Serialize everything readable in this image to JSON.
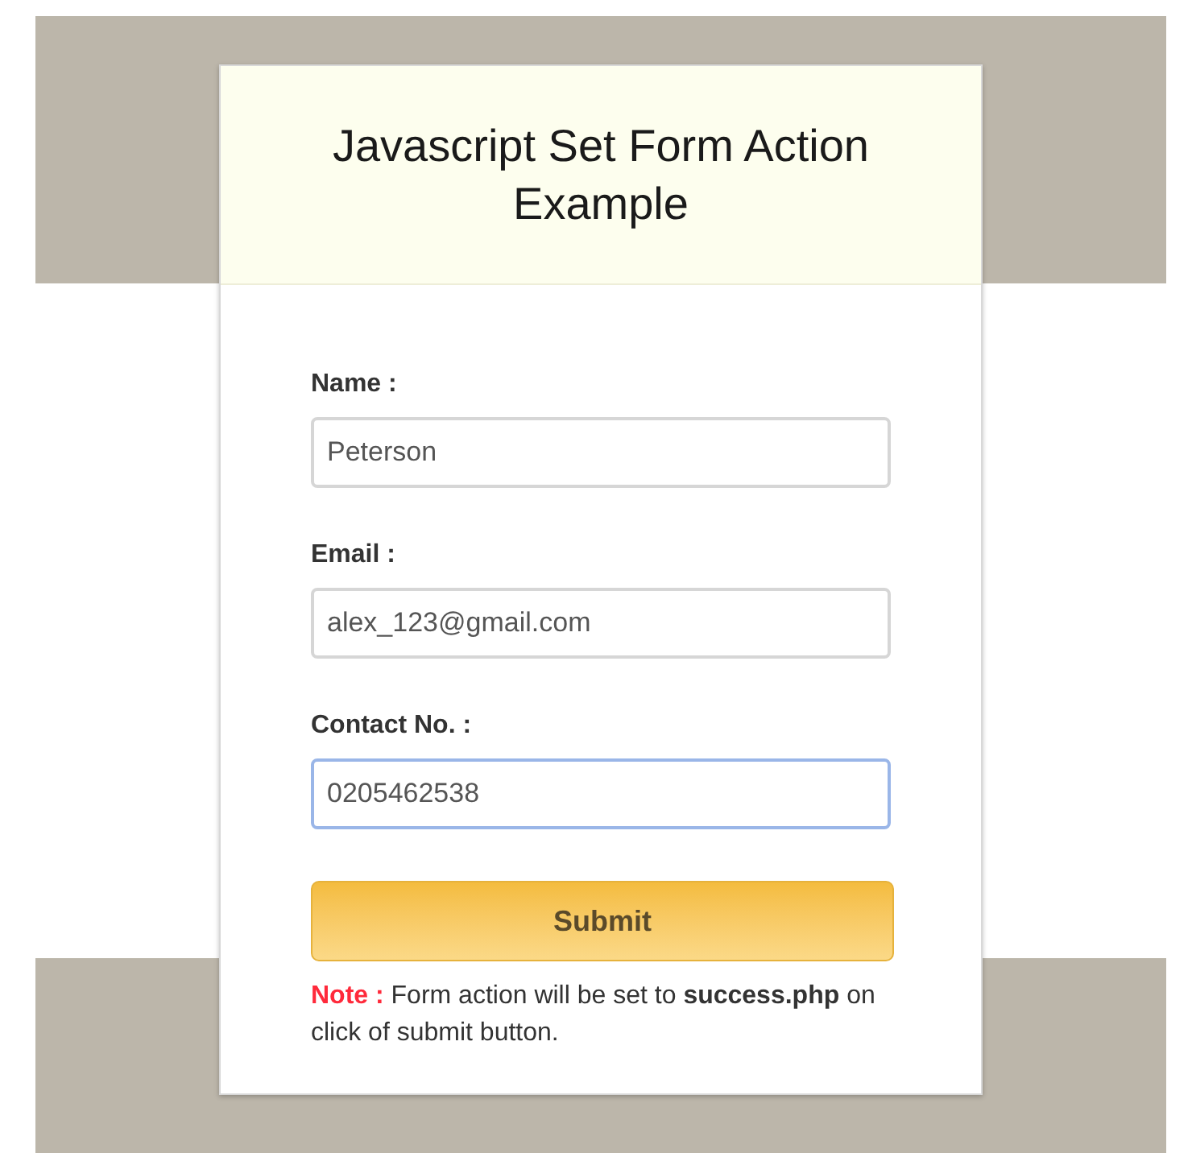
{
  "title": "Javascript Set Form Action Example",
  "fields": [
    {
      "label": "Name :",
      "value": "Peterson",
      "focused": false
    },
    {
      "label": "Email :",
      "value": "alex_123@gmail.com",
      "focused": false
    },
    {
      "label": "Contact No. :",
      "value": "0205462538",
      "focused": true
    }
  ],
  "button": "Submit",
  "note": {
    "label": "Note :",
    "text": "Form action will be set to **success.php** on click of submit button."
  }
}
